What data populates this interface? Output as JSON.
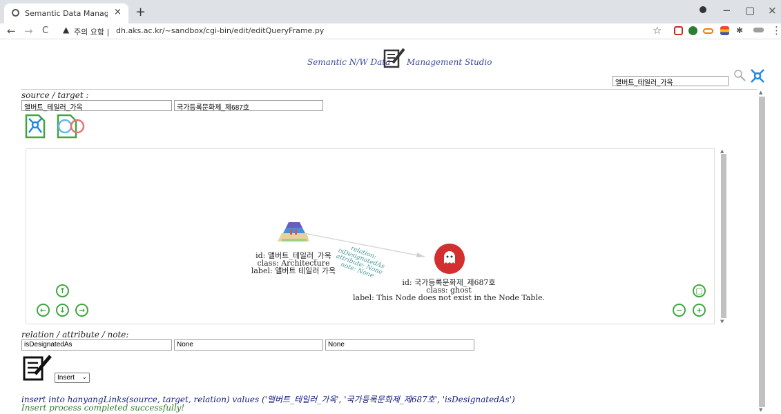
{
  "browser": {
    "tab_title": "Semantic Data Management St",
    "tab_close": "×",
    "new_tab": "+",
    "back": "←",
    "forward": "→",
    "reload": "C",
    "security_text": "주의 요함 |",
    "url": "dh.aks.ac.kr/~sandbox/cgi-bin/edit/editQueryFrame.py",
    "star": "☆",
    "minimize": "−",
    "maximize": "▢",
    "close": "×"
  },
  "app": {
    "title_left": "Semantic N/W Data",
    "title_right": "Management Studio",
    "top_search_value": "앨버트_테일러_가옥"
  },
  "form": {
    "source_target_label": "source / target :",
    "source_value": "앨버트_테일러_가옥",
    "target_value": "국가등록문화제_제687호",
    "relation_label": "relation / attribute / note:",
    "relation_value": "isDesignatedAs",
    "attribute_value": "None",
    "note_value": "None",
    "select_value": "Insert"
  },
  "graph": {
    "edge_relation": "relation: isDesignatedAs",
    "edge_attribute": "attribute: None",
    "edge_note": "note: None",
    "source_node": {
      "id": "id: 앨버트_테일러_가옥",
      "class": "class: Architecture",
      "label": "label: 앨버트 테일러 가옥"
    },
    "target_node": {
      "id": "id: 국가등록문화제_제687호",
      "class": "class: ghost",
      "label": "label: This Node does not exist in the Node Table."
    }
  },
  "result": {
    "sql": "insert into hanyangLinks(source, target, relation) values ('앨버트_테일러_가옥', '국가등록문화제_제687호', 'isDesignatedAs')",
    "message": "Insert process completed successfully!"
  },
  "colors": {
    "accent_green": "#3fa63f",
    "title_blue": "#3a4a9a",
    "ghost_red": "#d32f2f",
    "icon_blue": "#1e88e5"
  }
}
